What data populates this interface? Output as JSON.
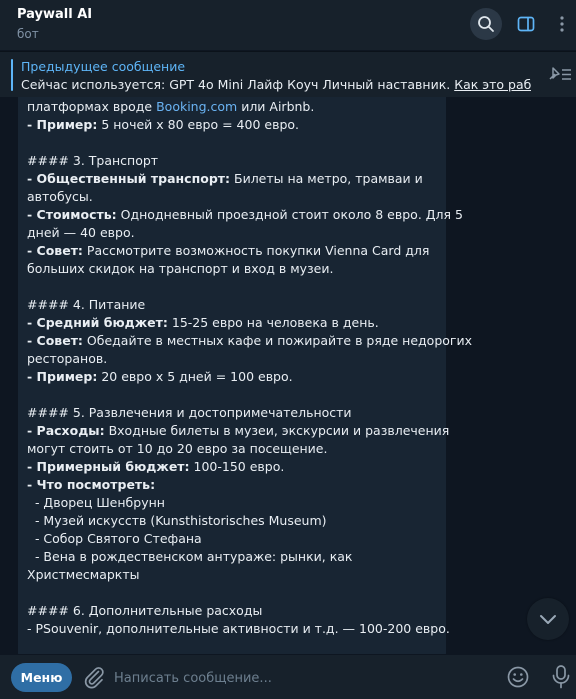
{
  "header": {
    "title": "Paywall AI",
    "subtitle": "бот"
  },
  "pinned": {
    "title": "Предыдущее сообщение",
    "text_prefix": "Сейчас используется: GPT 4o Mini Лайф Коуч Личный наставник. ",
    "text_link": "Как это работа..."
  },
  "message": {
    "line01": {
      "pre": "платформах вроде ",
      "link": "Booking.com",
      "post": " или Airbnb."
    },
    "line02": {
      "bold": "- Пример:",
      "text": " 5 ночей x 80 евро = 400 евро."
    },
    "line03": "#### 3. Транспорт",
    "line04": {
      "bold": "- Общественный транспорт:",
      "text": " Билеты на метро, трамваи и"
    },
    "line05": "автобусы.",
    "line06": {
      "bold": "- Стоимость:",
      "text": " Однодневный проездной стоит около 8 евро. Для 5"
    },
    "line07": "дней — 40 евро.",
    "line08": {
      "bold": "- Совет:",
      "text": " Рассмотрите возможность покупки Vienna Card для"
    },
    "line09": "больших скидок на транспорт и вход в музеи.",
    "line10": "#### 4. Питание",
    "line11": {
      "bold": "- Средний бюджет:",
      "text": " 15-25 евро на человека в день."
    },
    "line12": {
      "bold": "- Совет:",
      "text": " Обедайте в местных кафе и пожирайте в ряде недорогих"
    },
    "line13": "ресторанов.",
    "line14": {
      "bold": "- Пример:",
      "text": " 20 евро x 5 дней = 100 евро."
    },
    "line15": "#### 5. Развлечения и достопримечательности",
    "line16": {
      "bold": "- Расходы:",
      "text": " Входные билеты в музеи, экскурсии и развлечения"
    },
    "line17": "могут стоить от 10 до 20 евро за посещение.",
    "line18": {
      "bold": "- Примерный бюджет:",
      "text": " 100-150 евро."
    },
    "line19": {
      "bold": "- Что посмотреть:",
      "text": ""
    },
    "line20": "  - Дворец Шенбрунн",
    "line21": "  - Музей искусств (Kunsthistorisches Museum)",
    "line22": "  - Собор Святого Стефана",
    "line23": "  - Вена в рождественском антураже: рынки, как",
    "line24": "Христмесмаркты",
    "line25": "#### 6. Дополнительные расходы",
    "line26": "- PSouvenir, дополнительные активности и т.д. — 100-200 евро."
  },
  "composer": {
    "menu_label": "Меню",
    "placeholder": "Написать сообщение..."
  },
  "icons": {
    "search": "search-icon",
    "sidebar": "sidebar-toggle-icon",
    "more": "more-vertical-icon",
    "unpin": "unpin-list-icon",
    "scroll": "chevron-down-icon",
    "attach": "paperclip-icon",
    "emoji": "emoji-icon",
    "mic": "microphone-icon"
  },
  "colors": {
    "background": "#0e1621",
    "panel": "#17212b",
    "bubble": "#182533",
    "accent": "#5eb5f7",
    "menu_button": "#2f6ea5"
  }
}
